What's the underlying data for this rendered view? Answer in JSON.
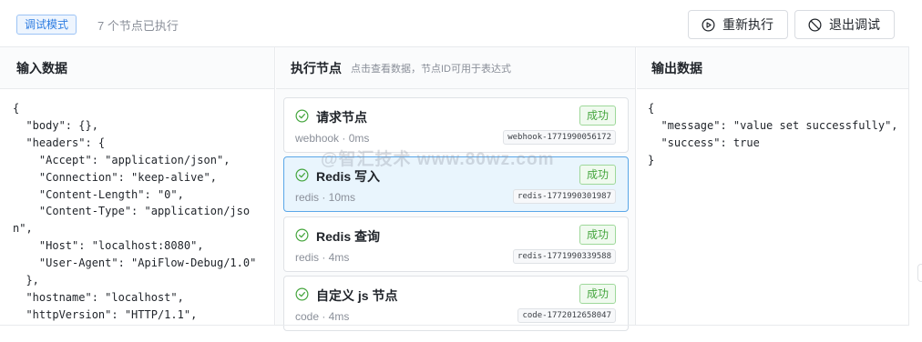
{
  "header": {
    "mode_badge": "调试模式",
    "exec_count": "7 个节点已执行",
    "rerun_label": "重新执行",
    "exit_label": "退出调试"
  },
  "input": {
    "title": "输入数据",
    "json_lines": "{\n  \"body\": {},\n  \"headers\": {\n    \"Accept\": \"application/json\",\n    \"Connection\": \"keep-alive\",\n    \"Content-Length\": \"0\",\n    \"Content-Type\": \"application/jso\nn\",\n    \"Host\": \"localhost:8080\",\n    \"User-Agent\": \"ApiFlow-Debug/1.0\"\n  },\n  \"hostname\": \"localhost\",\n  \"httpVersion\": \"HTTP/1.1\","
  },
  "nodes": {
    "title": "执行节点",
    "hint": "点击查看数据，节点ID可用于表达式",
    "items": [
      {
        "name": "请求节点",
        "status": "成功",
        "meta": "webhook · 0ms",
        "id": "webhook-1771990056172"
      },
      {
        "name": "Redis 写入",
        "status": "成功",
        "meta": "redis · 10ms",
        "id": "redis-1771990301987"
      },
      {
        "name": "Redis 查询",
        "status": "成功",
        "meta": "redis · 4ms",
        "id": "redis-1771990339588"
      },
      {
        "name": "自定义 js 节点",
        "status": "成功",
        "meta": "code · 4ms",
        "id": "code-1772012658047"
      }
    ]
  },
  "output": {
    "title": "输出数据",
    "json_lines": "{\n  \"message\": \"value set successfully\",\n  \"success\": true\n}"
  },
  "watermark": "@智汇技术 www.80wz.com",
  "colors": {
    "accent": "#2f7de1",
    "success": "#46a63f",
    "selected_bg": "#e9f5fd",
    "selected_border": "#5aa7e8"
  },
  "icons": {
    "rerun": "play-circle-icon",
    "exit": "ban-icon",
    "node_status": "check-circle-icon"
  }
}
